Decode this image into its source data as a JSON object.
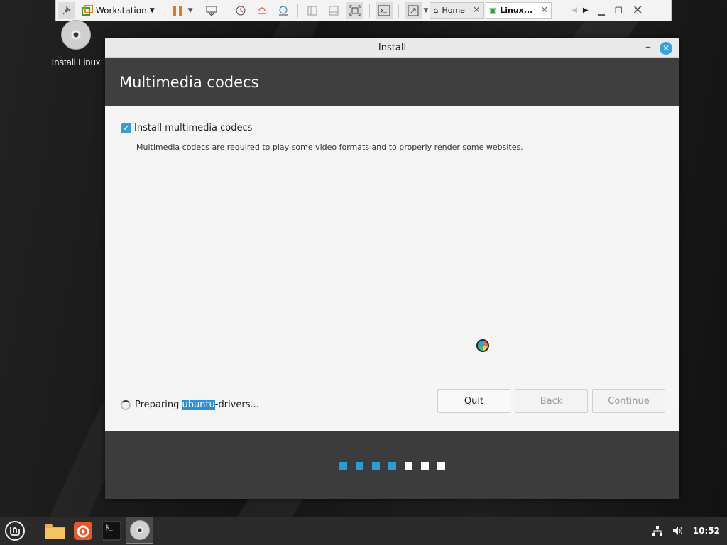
{
  "vm_toolbar": {
    "product_label": "Workstation",
    "tabs": [
      {
        "label": "Home",
        "active": false
      },
      {
        "label": "Linux...",
        "active": true
      }
    ]
  },
  "desktop": {
    "icons": [
      {
        "label": "Install Linux",
        "icon": "disc-icon"
      }
    ]
  },
  "window": {
    "title": "Install",
    "header": "Multimedia codecs",
    "checkbox": {
      "label": "Install multimedia codecs",
      "checked": true
    },
    "description": "Multimedia codecs are required to play some video formats and to properly render some websites.",
    "status": {
      "prefix": "Preparing ",
      "highlight": "ubuntu",
      "suffix": "-drivers..."
    },
    "buttons": {
      "quit": "Quit",
      "back": "Back",
      "continue": "Continue"
    },
    "progress": {
      "total_steps": 7,
      "completed_steps": 4
    },
    "colors": {
      "accent": "#2d8ed8",
      "step_done": "#2d9ad8",
      "step_todo": "#ffffff"
    }
  },
  "taskbar": {
    "items": [
      "mint-menu-icon",
      "files-icon",
      "firefox-icon",
      "terminal-icon",
      "disc-icon"
    ],
    "clock": "10:52"
  }
}
